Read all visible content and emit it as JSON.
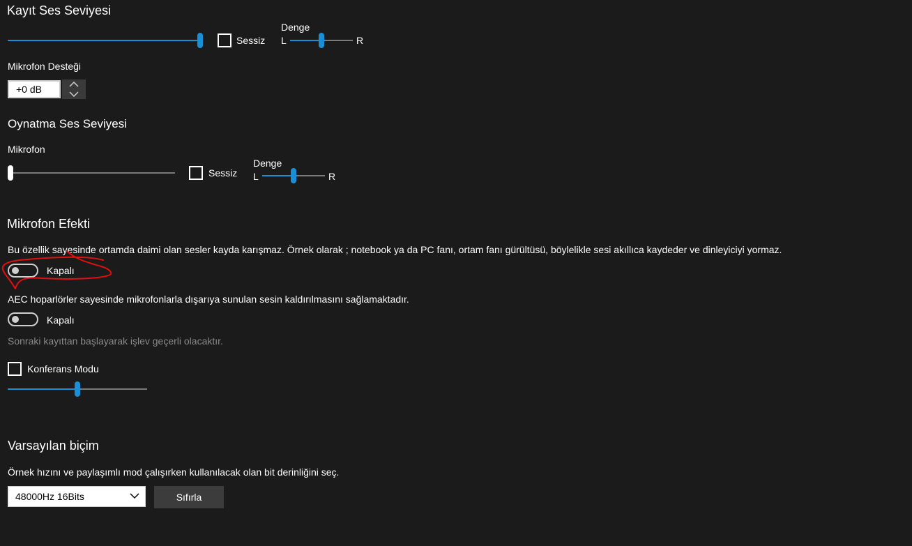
{
  "recording": {
    "title": "Kayıt Ses Seviyesi",
    "volume_percent": 100,
    "mute_label": "Sessiz",
    "balance_label": "Denge",
    "balance_left": "L",
    "balance_right": "R",
    "balance_percent": 50
  },
  "mic_boost": {
    "label": "Mikrofon Desteği",
    "value": "+0 dB"
  },
  "playback": {
    "title": "Oynatma Ses Seviyesi",
    "mic_label": "Mikrofon",
    "volume_percent": 0,
    "mute_label": "Sessiz",
    "balance_label": "Denge",
    "balance_left": "L",
    "balance_right": "R",
    "balance_percent": 50
  },
  "mic_effect": {
    "title": "Mikrofon Efekti",
    "noise_desc": "Bu özellik sayesinde ortamda daimi olan sesler kayda karışmaz. Örnek olarak ; notebook ya da PC fanı, ortam fanı gürültüsü, böylelikle sesi akıllıca kaydeder ve dinleyiciyi yormaz.",
    "noise_toggle_label": "Kapalı",
    "aec_desc": "AEC hoparlörler sayesinde mikrofonlarla dışarıya sunulan sesin kaldırılmasını sağlamaktadır.",
    "aec_toggle_label": "Kapalı",
    "note": "Sonraki kayıttan başlayarak işlev geçerli olacaktır.",
    "conference_label": "Konferans Modu",
    "conference_level_percent": 50
  },
  "default_format": {
    "title": "Varsayılan biçim",
    "desc": "Örnek hızını ve paylaşımlı mod çalışırken kullanılacak olan bit derinliğini seç.",
    "selected": "48000Hz 16Bits",
    "reset_label": "Sıfırla"
  },
  "colors": {
    "accent": "#1a8fd6",
    "background": "#1b1b1b",
    "annotation": "#e01010"
  }
}
